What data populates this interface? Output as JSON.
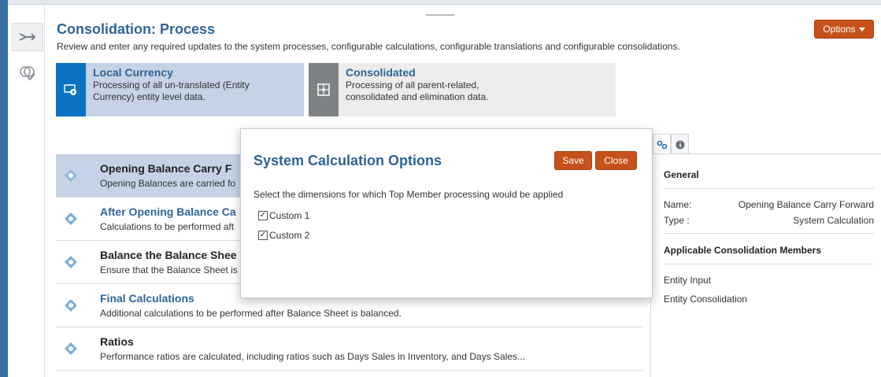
{
  "header": {
    "title": "Consolidation: Process",
    "subtitle": "Review and enter any required updates to the system processes, configurable calculations, configurable translations and configurable consolidations.",
    "options_label": "Options"
  },
  "tiles": {
    "local": {
      "title": "Local Currency",
      "desc_line1": "Processing of all un-translated (Entity",
      "desc_line2": "Currency) entity level data.",
      "icon": "currency-icon"
    },
    "consolidated": {
      "title": "Consolidated",
      "desc_line1": "Processing of all parent-related,",
      "desc_line2": "consolidated and elimination data.",
      "icon": "puzzle-icon"
    }
  },
  "rows": [
    {
      "title": "Opening Balance Carry F",
      "desc": "Opening Balances are carried fo",
      "selected": true
    },
    {
      "title": "After Opening Balance Ca",
      "desc": "Calculations to be performed aft"
    },
    {
      "title": "Balance the Balance Shee",
      "desc": "Ensure that the Balance Sheet is"
    },
    {
      "title": "Final Calculations",
      "desc": "Additional calculations to be performed after Balance Sheet is balanced."
    },
    {
      "title": "Ratios",
      "desc": "Performance ratios are calculated, including ratios such as Days Sales in Inventory, and Days Sales..."
    }
  ],
  "panel": {
    "general_heading": "General",
    "name_label": "Name:",
    "name_value": "Opening Balance Carry Forward",
    "type_label": "Type :",
    "type_value": "System Calculation",
    "members_heading": "Applicable Consolidation Members",
    "members": [
      "Entity Input",
      "Entity Consolidation"
    ]
  },
  "dialog": {
    "title": "System Calculation Options",
    "save_label": "Save",
    "close_label": "Close",
    "instruction": "Select the dimensions for which Top Member processing would be applied",
    "options": [
      {
        "label": "Custom 1",
        "checked": true
      },
      {
        "label": "Custom 2",
        "checked": true
      }
    ]
  },
  "colors": {
    "accent": "#c7511a",
    "title_blue": "#2e6598",
    "selected_row": "#c6d2e6",
    "local_icon_bg": "#0a73c4"
  }
}
